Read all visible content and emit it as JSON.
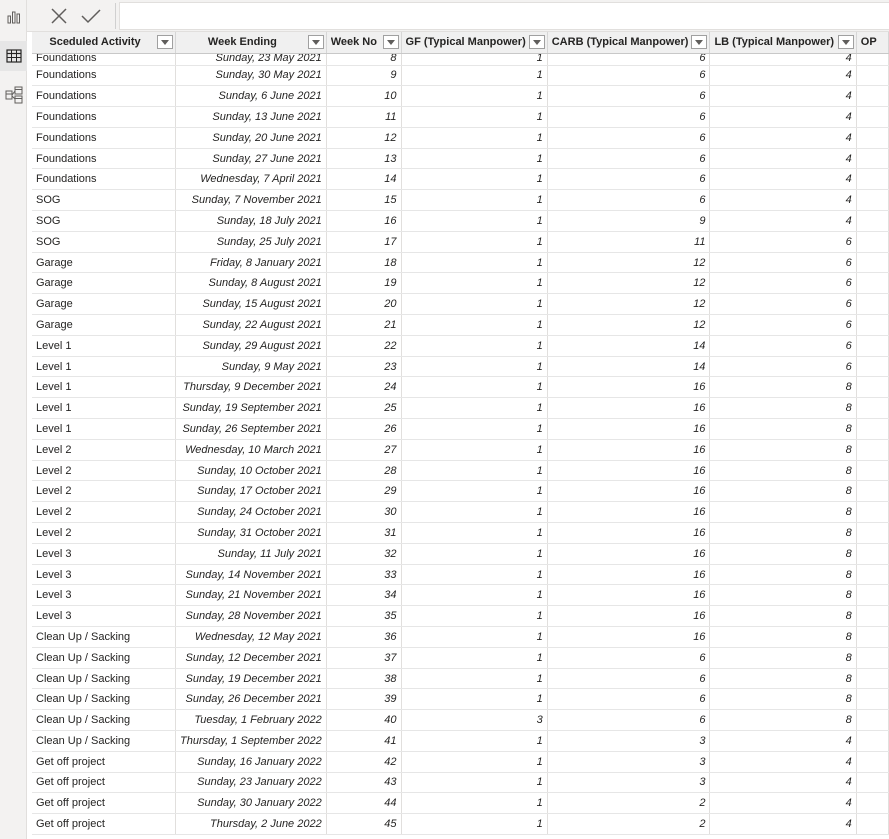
{
  "rail": {
    "icons": [
      "report-view-icon",
      "table-view-icon",
      "model-view-icon"
    ]
  },
  "formula_bar": {
    "cancel_icon": "close-icon",
    "commit_icon": "checkmark-icon",
    "value": ""
  },
  "table": {
    "columns": [
      {
        "label": "Sceduled Activity",
        "align": "center"
      },
      {
        "label": "Week Ending",
        "align": "center"
      },
      {
        "label": "Week No",
        "align": "left"
      },
      {
        "label": "GF (Typical Manpower)",
        "align": "left"
      },
      {
        "label": "CARB (Typical Manpower)",
        "align": "left"
      },
      {
        "label": "LB (Typical Manpower)",
        "align": "left"
      },
      {
        "label": "OP",
        "align": "left"
      }
    ],
    "rows": [
      [
        "Foundations",
        "Sunday, 23 May 2021",
        "8",
        "1",
        "6",
        "4"
      ],
      [
        "Foundations",
        "Sunday, 30 May 2021",
        "9",
        "1",
        "6",
        "4"
      ],
      [
        "Foundations",
        "Sunday, 6 June 2021",
        "10",
        "1",
        "6",
        "4"
      ],
      [
        "Foundations",
        "Sunday, 13 June 2021",
        "11",
        "1",
        "6",
        "4"
      ],
      [
        "Foundations",
        "Sunday, 20 June 2021",
        "12",
        "1",
        "6",
        "4"
      ],
      [
        "Foundations",
        "Sunday, 27 June 2021",
        "13",
        "1",
        "6",
        "4"
      ],
      [
        "Foundations",
        "Wednesday, 7 April 2021",
        "14",
        "1",
        "6",
        "4"
      ],
      [
        "SOG",
        "Sunday, 7 November 2021",
        "15",
        "1",
        "6",
        "4"
      ],
      [
        "SOG",
        "Sunday, 18 July 2021",
        "16",
        "1",
        "9",
        "4"
      ],
      [
        "SOG",
        "Sunday, 25 July 2021",
        "17",
        "1",
        "11",
        "6"
      ],
      [
        "Garage",
        "Friday, 8 January 2021",
        "18",
        "1",
        "12",
        "6"
      ],
      [
        "Garage",
        "Sunday, 8 August 2021",
        "19",
        "1",
        "12",
        "6"
      ],
      [
        "Garage",
        "Sunday, 15 August 2021",
        "20",
        "1",
        "12",
        "6"
      ],
      [
        "Garage",
        "Sunday, 22 August 2021",
        "21",
        "1",
        "12",
        "6"
      ],
      [
        "Level 1",
        "Sunday, 29 August 2021",
        "22",
        "1",
        "14",
        "6"
      ],
      [
        "Level 1",
        "Sunday, 9 May 2021",
        "23",
        "1",
        "14",
        "6"
      ],
      [
        "Level 1",
        "Thursday, 9 December 2021",
        "24",
        "1",
        "16",
        "8"
      ],
      [
        "Level 1",
        "Sunday, 19 September 2021",
        "25",
        "1",
        "16",
        "8"
      ],
      [
        "Level 1",
        "Sunday, 26 September 2021",
        "26",
        "1",
        "16",
        "8"
      ],
      [
        "Level 2",
        "Wednesday, 10 March 2021",
        "27",
        "1",
        "16",
        "8"
      ],
      [
        "Level 2",
        "Sunday, 10 October 2021",
        "28",
        "1",
        "16",
        "8"
      ],
      [
        "Level 2",
        "Sunday, 17 October 2021",
        "29",
        "1",
        "16",
        "8"
      ],
      [
        "Level 2",
        "Sunday, 24 October 2021",
        "30",
        "1",
        "16",
        "8"
      ],
      [
        "Level 2",
        "Sunday, 31 October 2021",
        "31",
        "1",
        "16",
        "8"
      ],
      [
        "Level 3",
        "Sunday, 11 July 2021",
        "32",
        "1",
        "16",
        "8"
      ],
      [
        "Level 3",
        "Sunday, 14 November 2021",
        "33",
        "1",
        "16",
        "8"
      ],
      [
        "Level 3",
        "Sunday, 21 November 2021",
        "34",
        "1",
        "16",
        "8"
      ],
      [
        "Level 3",
        "Sunday, 28 November 2021",
        "35",
        "1",
        "16",
        "8"
      ],
      [
        "Clean Up / Sacking",
        "Wednesday, 12 May 2021",
        "36",
        "1",
        "16",
        "8"
      ],
      [
        "Clean Up / Sacking",
        "Sunday, 12 December 2021",
        "37",
        "1",
        "6",
        "8"
      ],
      [
        "Clean Up / Sacking",
        "Sunday, 19 December 2021",
        "38",
        "1",
        "6",
        "8"
      ],
      [
        "Clean Up / Sacking",
        "Sunday, 26 December 2021",
        "39",
        "1",
        "6",
        "8"
      ],
      [
        "Clean Up / Sacking",
        "Tuesday, 1 February 2022",
        "40",
        "3",
        "6",
        "8"
      ],
      [
        "Clean Up / Sacking",
        "Thursday, 1 September 2022",
        "41",
        "1",
        "3",
        "4"
      ],
      [
        "Get off project",
        "Sunday, 16 January 2022",
        "42",
        "1",
        "3",
        "4"
      ],
      [
        "Get off project",
        "Sunday, 23 January 2022",
        "43",
        "1",
        "3",
        "4"
      ],
      [
        "Get off project",
        "Sunday, 30 January 2022",
        "44",
        "1",
        "2",
        "4"
      ],
      [
        "Get off project",
        "Thursday, 2 June 2022",
        "45",
        "1",
        "2",
        "4"
      ]
    ]
  }
}
